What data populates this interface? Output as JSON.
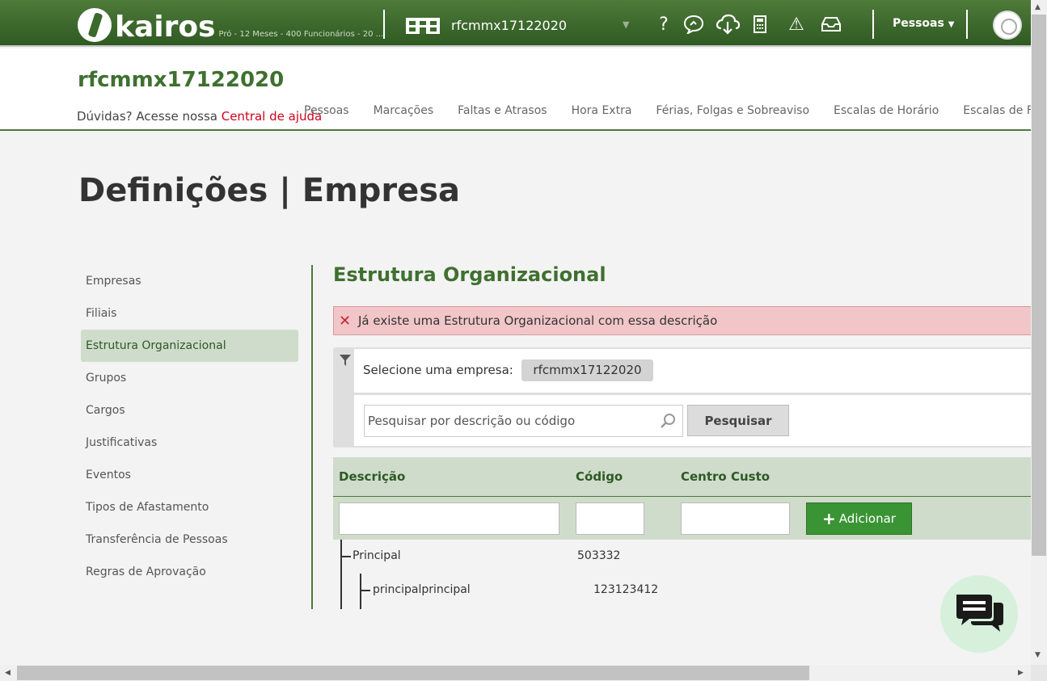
{
  "topbar": {
    "logo_text": "kairos",
    "logo_subtitle": "Pró - 12 Meses - 400 Funcionários - 20 ...",
    "company_selected": "rfcmmx17122020",
    "pessoas_menu": "Pessoas",
    "help_icon_glyph": "?",
    "warning_icon_glyph": "⚠"
  },
  "header": {
    "company_name": "rfcmmx17122020",
    "help_prefix": "Dúvidas? Acesse nossa ",
    "help_link": "Central de ajuda",
    "nav": [
      "Pessoas",
      "Marcações",
      "Faltas e Atrasos",
      "Hora Extra",
      "Férias, Folgas e Sobreaviso",
      "Escalas de Horário",
      "Escalas de Folgas"
    ]
  },
  "page_title": "Definições | Empresa",
  "sidebar": {
    "items": [
      {
        "label": "Empresas",
        "active": false
      },
      {
        "label": "Filiais",
        "active": false
      },
      {
        "label": "Estrutura Organizacional",
        "active": true
      },
      {
        "label": "Grupos",
        "active": false
      },
      {
        "label": "Cargos",
        "active": false
      },
      {
        "label": "Justificativas",
        "active": false
      },
      {
        "label": "Eventos",
        "active": false
      },
      {
        "label": "Tipos de Afastamento",
        "active": false
      },
      {
        "label": "Transferência de Pessoas",
        "active": false
      },
      {
        "label": "Regras de Aprovação",
        "active": false
      }
    ]
  },
  "main": {
    "section_title": "Estrutura Organizacional",
    "alert_icon": "✕",
    "alert_text": "Já existe uma Estrutura Organizacional com essa descrição",
    "filter": {
      "select_label": "Selecione uma empresa:",
      "selected_company": "rfcmmx17122020",
      "search_placeholder": "Pesquisar por descrição ou código",
      "search_button": "Pesquisar"
    },
    "table": {
      "headers": [
        "Descrição",
        "Código",
        "Centro Custo"
      ],
      "add_button": "Adicionar",
      "add_icon": "+",
      "rows": [
        {
          "descricao": "Principal",
          "codigo": "503332"
        },
        {
          "descricao": "principalprincipal",
          "codigo": "123123412"
        }
      ]
    }
  },
  "colors": {
    "brand_green": "#3f7030",
    "alert_bg": "#f2c6c8",
    "add_button": "#3a9434",
    "help_link": "#d0021b"
  }
}
